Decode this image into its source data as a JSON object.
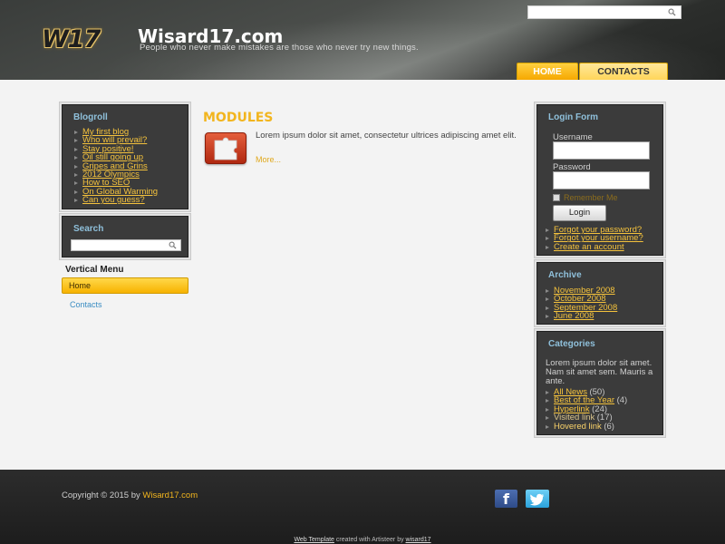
{
  "header": {
    "logo_mark": "W17",
    "site_title": "Wisard17.com",
    "slogan": "People who never make mistakes are those who never try new things.",
    "search_placeholder": ""
  },
  "nav": {
    "items": [
      {
        "label": "HOME",
        "active": true
      },
      {
        "label": "CONTACTS",
        "active": false
      }
    ]
  },
  "blogroll": {
    "title": "Blogroll",
    "items": [
      "My first blog",
      "Who will prevail?",
      "Stay positive!",
      "Oil still going up",
      "Gripes and Grins",
      "2012 Olympics",
      "How to SEO",
      "On Global Warming",
      "Can you guess?"
    ]
  },
  "search_block": {
    "title": "Search",
    "placeholder": ""
  },
  "vertical_menu": {
    "title": "Vertical Menu",
    "items": [
      "Home",
      "Contacts"
    ]
  },
  "main": {
    "title": "MODULES",
    "text": "Lorem ipsum dolor sit amet, consectetur ultrices adipiscing amet elit.",
    "more": "More..."
  },
  "login": {
    "title": "Login Form",
    "username_label": "Username",
    "password_label": "Password",
    "remember": "Remember Me",
    "button": "Login",
    "links": [
      "Forgot your password?",
      "Forgot your username?",
      "Create an account"
    ]
  },
  "archive": {
    "title": "Archive",
    "items": [
      "November 2008",
      "October 2008",
      "September 2008",
      "June 2008"
    ]
  },
  "categories": {
    "title": "Categories",
    "description": "Lorem ipsum dolor sit amet. Nam sit amet sem. Mauris a ante.",
    "items": [
      {
        "label": "All News",
        "count": "(50)"
      },
      {
        "label": "Best of the Year",
        "count": "(4)"
      },
      {
        "label": "Hyperlink",
        "count": "(24)"
      },
      {
        "label": "Visited link",
        "count": "(17)"
      },
      {
        "label": "Hovered link",
        "count": "(6)"
      }
    ]
  },
  "footer": {
    "copyright_prefix": "Copyright © 2015 by ",
    "copyright_brand": "Wisard17.com",
    "credit_link": "Web Template",
    "credit_middle": " created with Artisteer by ",
    "credit_author": "wisard17"
  },
  "colors": {
    "accent": "#f2b51e",
    "block_bg": "#3b3b3b",
    "block_title": "#8fc0db",
    "link": "#f4c23c"
  },
  "icons": [
    "search-icon",
    "puzzle-icon",
    "facebook-icon",
    "twitter-icon"
  ]
}
